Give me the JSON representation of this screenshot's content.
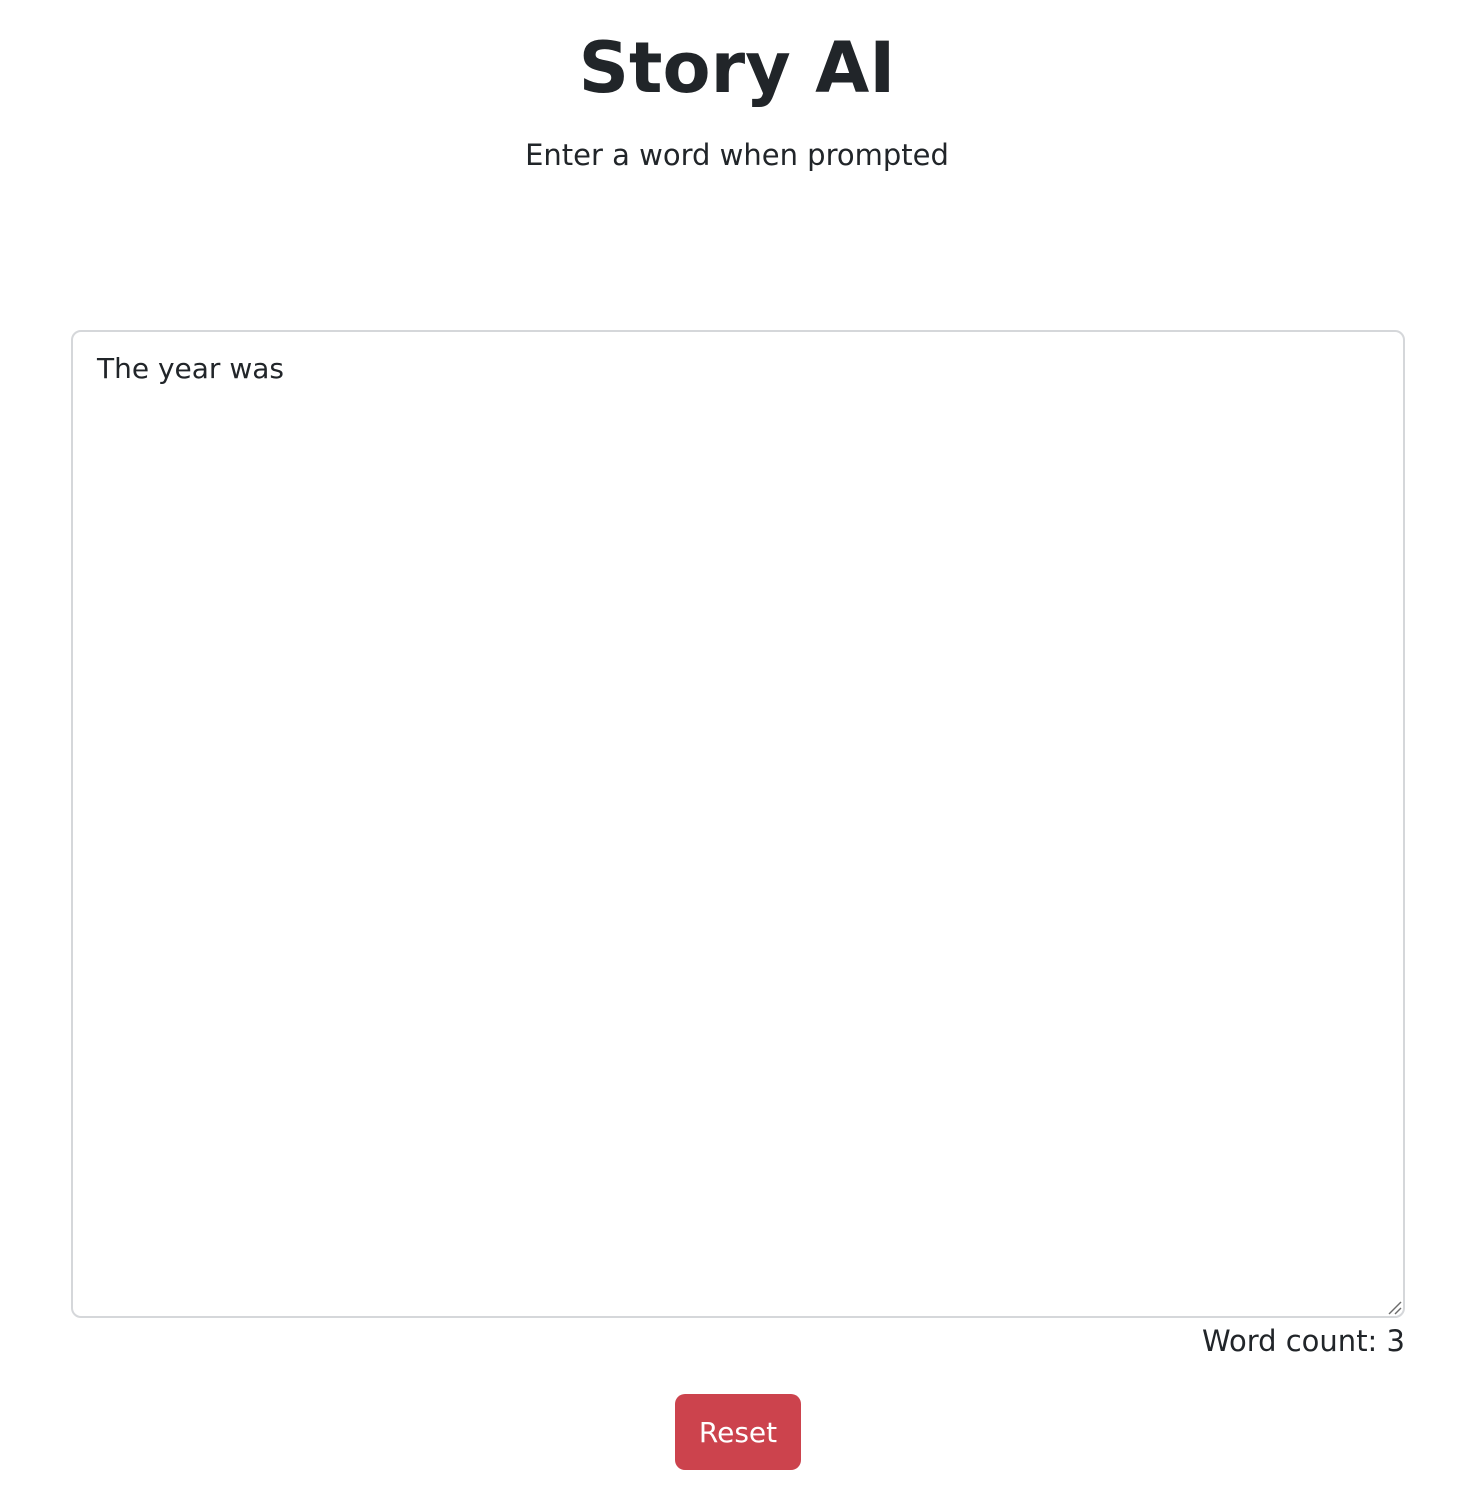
{
  "header": {
    "title": "Story AI",
    "subtitle": "Enter a word when prompted"
  },
  "story": {
    "text": "The year was",
    "word_count_label": "Word count: 3"
  },
  "actions": {
    "reset_label": "Reset"
  },
  "colors": {
    "reset_button": "#cc434d",
    "text": "#212529",
    "border": "#d5d7da"
  }
}
